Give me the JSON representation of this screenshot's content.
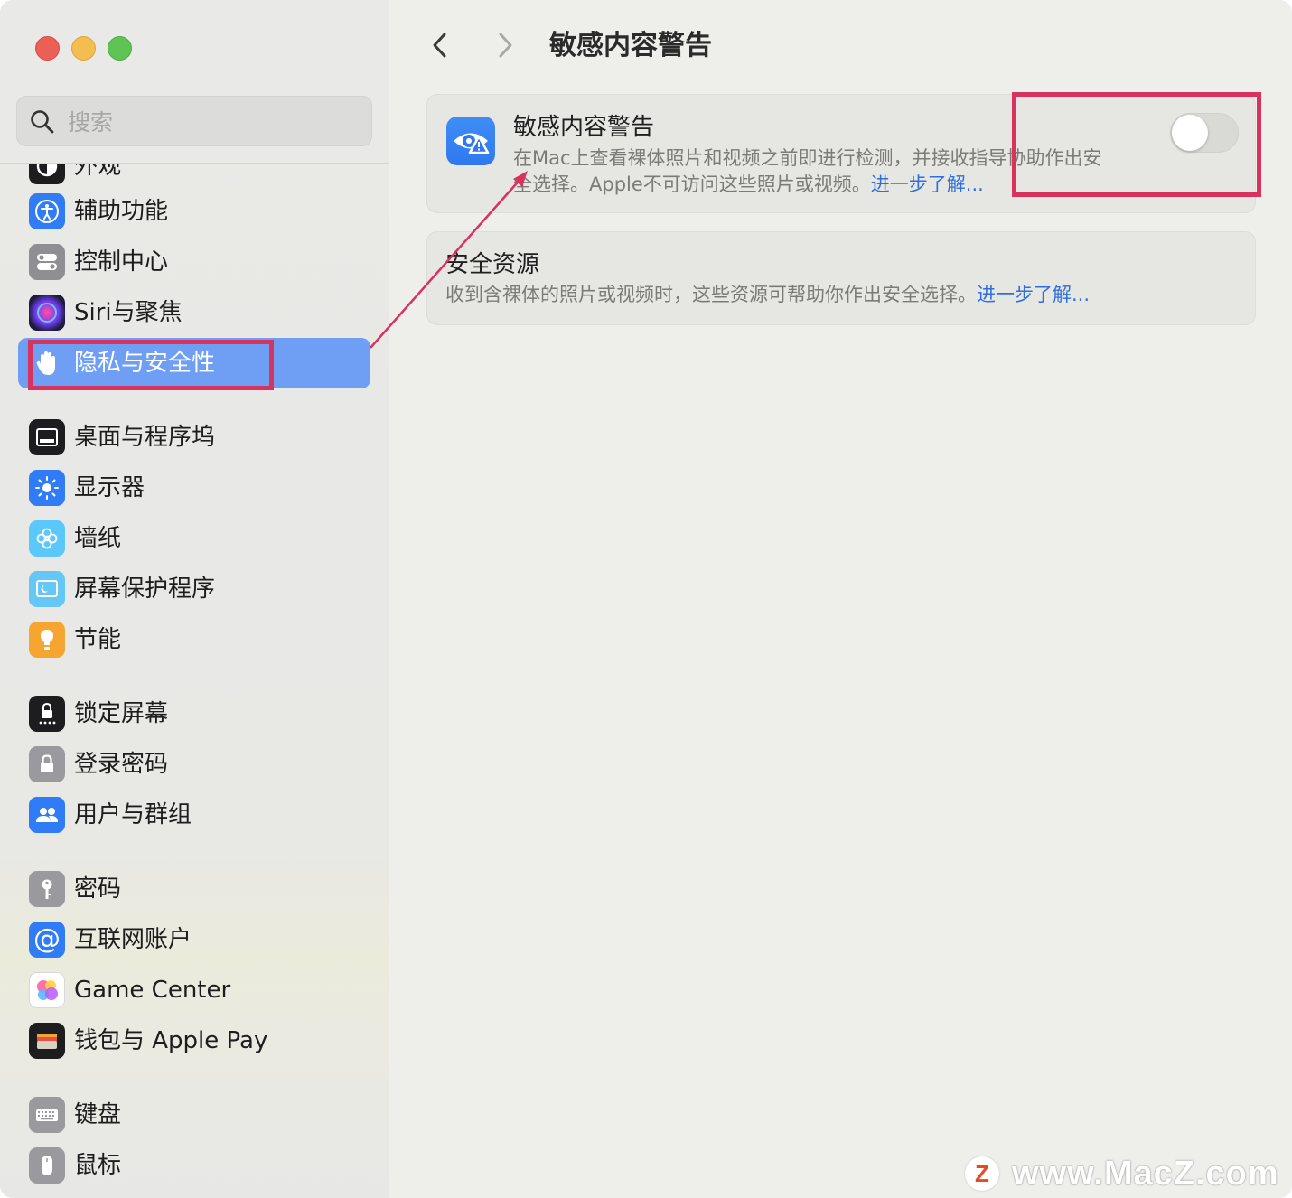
{
  "window": {
    "traffic_lights": [
      "close",
      "minimize",
      "zoom"
    ]
  },
  "sidebar": {
    "search": {
      "placeholder": "搜索",
      "value": ""
    },
    "items": [
      {
        "label": "外观",
        "icon": "appearance-icon",
        "color": "#1d1d1f",
        "partial": true
      },
      {
        "label": "辅助功能",
        "icon": "accessibility-icon",
        "color": "#2f7cf6"
      },
      {
        "label": "控制中心",
        "icon": "control-center-icon",
        "color": "#8e8e93"
      },
      {
        "label": "Siri与聚焦",
        "icon": "siri-icon",
        "color": "#1b1b3a"
      },
      {
        "label": "隐私与安全性",
        "icon": "hand-icon",
        "color": "#3e7cf0",
        "selected": true
      },
      {
        "label": "桌面与程序坞",
        "icon": "dock-icon",
        "color": "#1d1d1f"
      },
      {
        "label": "显示器",
        "icon": "brightness-icon",
        "color": "#2f7cf6"
      },
      {
        "label": "墙纸",
        "icon": "wallpaper-flower-icon",
        "color": "#5ac8fa"
      },
      {
        "label": "屏幕保护程序",
        "icon": "screensaver-icon",
        "color": "#64c7f5"
      },
      {
        "label": "节能",
        "icon": "lightbulb-icon",
        "color": "#f7a531"
      },
      {
        "label": "锁定屏幕",
        "icon": "lock-screen-icon",
        "color": "#1d1d1f"
      },
      {
        "label": "登录密码",
        "icon": "padlock-icon",
        "color": "#9a9a9e"
      },
      {
        "label": "用户与群组",
        "icon": "users-icon",
        "color": "#2f7cf6"
      },
      {
        "label": "密码",
        "icon": "key-icon",
        "color": "#9a9a9e"
      },
      {
        "label": "互联网账户",
        "icon": "at-sign-icon",
        "color": "#2f7cf6"
      },
      {
        "label": "Game Center",
        "icon": "game-center-icon",
        "color": "#ffffff"
      },
      {
        "label": "钱包与 Apple Pay",
        "icon": "wallet-icon",
        "color": "#1d1d1f"
      },
      {
        "label": "键盘",
        "icon": "keyboard-icon",
        "color": "#9a9a9e"
      },
      {
        "label": "鼠标",
        "icon": "mouse-icon",
        "color": "#9a9a9e"
      }
    ]
  },
  "main": {
    "title": "敏感内容警告",
    "card1": {
      "title": "敏感内容警告",
      "desc_line1": "在Mac上查看裸体照片和视频之前即进行检测，并接收指导协助作出安",
      "desc_line2": "全选择。Apple不可访问这些照片或视频。",
      "link": "进一步了解...",
      "toggle_on": false
    },
    "card2": {
      "title": "安全资源",
      "desc": "收到含裸体的照片或视频时，这些资源可帮助你作出安全选择。",
      "link": "进一步了解..."
    }
  },
  "annotations": {
    "color": "#d8325e"
  },
  "watermark": {
    "logo": "Z",
    "text": "www.MacZ.com"
  }
}
